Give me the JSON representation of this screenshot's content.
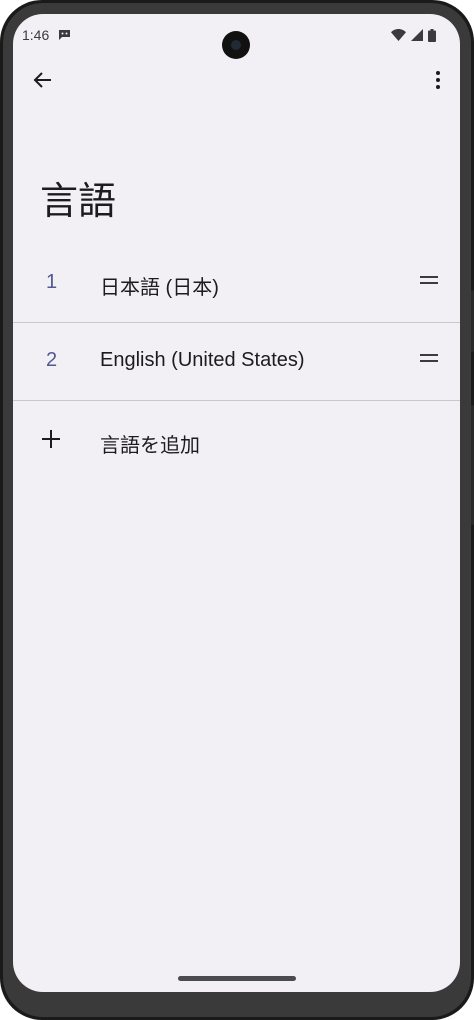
{
  "status_bar": {
    "time": "1:46",
    "icons": [
      "chat-notification-icon",
      "wifi-icon",
      "cell-signal-icon",
      "battery-icon"
    ]
  },
  "app_bar": {
    "back_icon": "arrow-back-icon",
    "more_icon": "more-vert-icon"
  },
  "page": {
    "title": "言語"
  },
  "languages": [
    {
      "index": "1",
      "label": "日本語 (日本)"
    },
    {
      "index": "2",
      "label": "English (United States)"
    }
  ],
  "add_language": {
    "icon": "plus-icon",
    "label": "言語を追加"
  },
  "colors": {
    "background": "#f2f0f4",
    "index_accent": "#4f5b92",
    "text": "#1c1b1f",
    "divider": "#c9c6cc"
  }
}
